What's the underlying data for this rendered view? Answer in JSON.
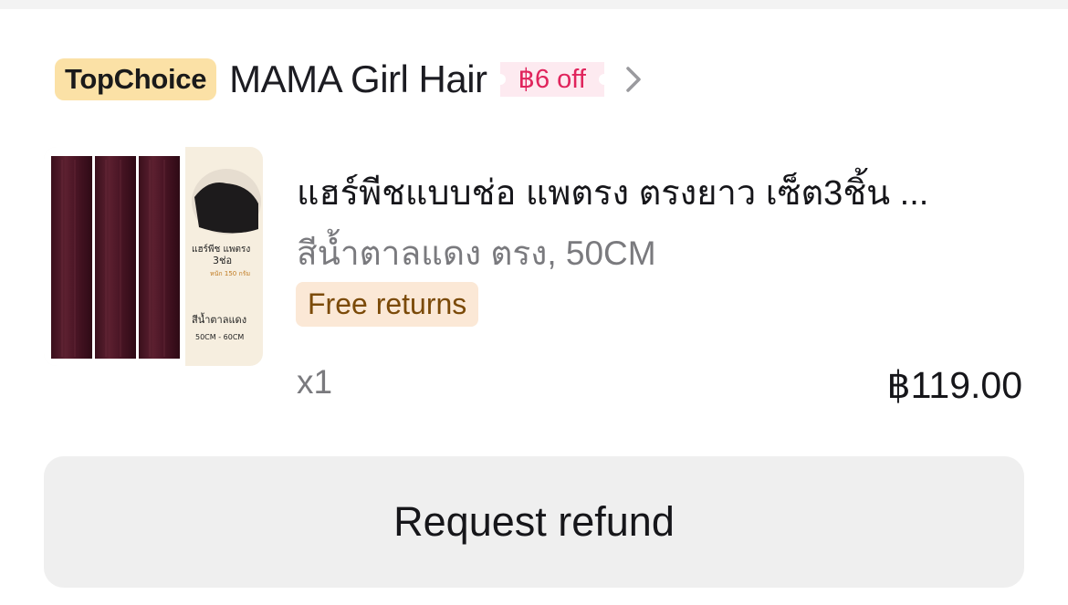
{
  "store": {
    "badge": "TopChoice",
    "name": "MAMA Girl Hair",
    "discount": "฿6 off",
    "chevron_icon": "chevron-right-icon"
  },
  "product": {
    "image_text": {
      "name": "แฮร์พีช แพตรง",
      "pieces": "3ช่อ",
      "weight": "หนัก 150 กรัม",
      "color": "สีน้ำตาลแดง",
      "size": "50CM - 60CM"
    },
    "title": "แฮร์พีชแบบช่อ แพตรง ตรงยาว เซ็ต3ชิ้น ...",
    "variant": "สีน้ำตาลแดง ตรง, 50CM",
    "badge": "Free returns",
    "quantity": "x1",
    "price": "฿119.00"
  },
  "actions": {
    "refund_label": "Request refund"
  },
  "colors": {
    "topchoice_bg": "#fbe1a6",
    "discount_text": "#e0245c",
    "discount_bg": "#fdeaf0",
    "free_returns_bg": "#fbe8d6",
    "free_returns_text": "#7b4a08",
    "button_bg": "#efefef"
  }
}
